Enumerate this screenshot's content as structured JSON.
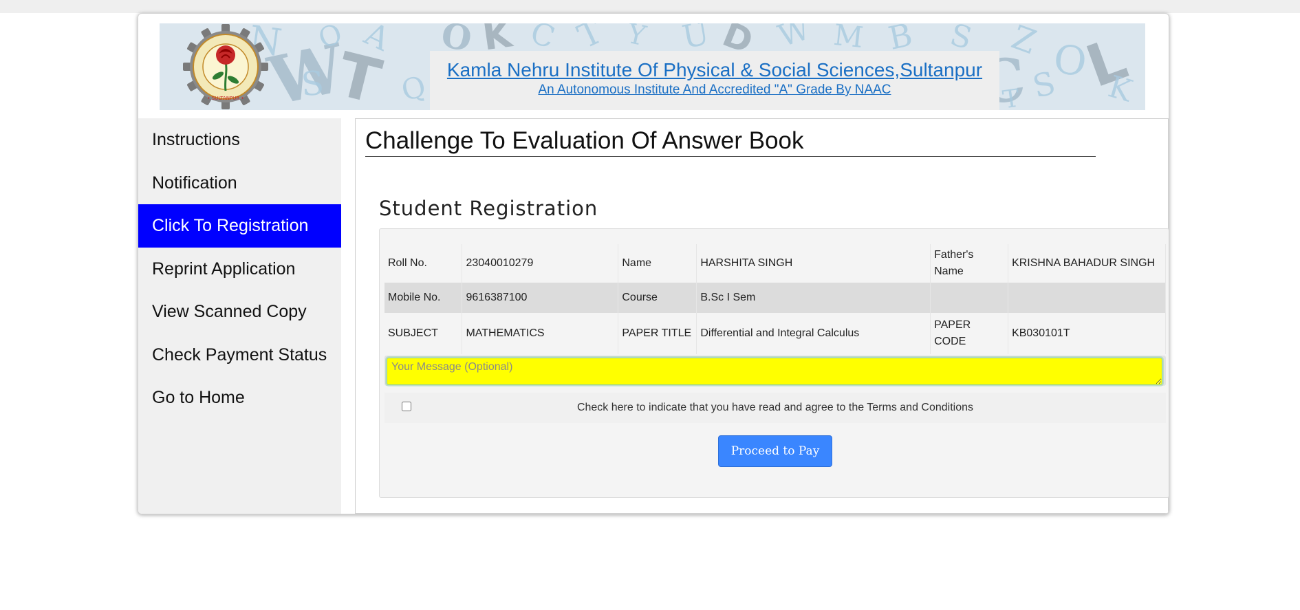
{
  "header": {
    "institute_name": "Kamla Nehru Institute Of Physical & Social Sciences,Sultanpur",
    "subtitle": "An Autonomous Institute And Accredited \"A\" Grade By NAAC",
    "logo_icon": "institute-seal-rose-icon",
    "logo_text": "KAMLA NEHRU INSTITUTE OF PHYSICAL & SOCIAL SCIENCES • SULTANPUR •"
  },
  "sidebar": {
    "items": [
      {
        "label": "Instructions",
        "active": false
      },
      {
        "label": "Notification",
        "active": false
      },
      {
        "label": "Click To Registration",
        "active": true
      },
      {
        "label": "Reprint Application",
        "active": false
      },
      {
        "label": "View Scanned Copy",
        "active": false
      },
      {
        "label": "Check Payment Status",
        "active": false
      },
      {
        "label": "Go to Home",
        "active": false
      }
    ]
  },
  "main": {
    "page_title": "Challenge To Evaluation Of Answer Book",
    "section_title": "Student Registration",
    "student": {
      "roll_label": "Roll No.",
      "roll_value": "23040010279",
      "name_label": "Name",
      "name_value": "HARSHITA SINGH",
      "father_label": "Father's Name",
      "father_value": "KRISHNA BAHADUR SINGH",
      "mobile_label": "Mobile No.",
      "mobile_value": "9616387100",
      "course_label": "Course",
      "course_value": "B.Sc I Sem",
      "subject_label": "SUBJECT",
      "subject_value": "MATHEMATICS",
      "paper_title_label": "PAPER TITLE",
      "paper_title_value": "Differential and Integral Calculus",
      "paper_code_label": "PAPER CODE",
      "paper_code_value": "KB030101T"
    },
    "message": {
      "placeholder": "Your Message (Optional)",
      "value": ""
    },
    "terms": {
      "label": "Check here to indicate that you have read and agree to the Terms and Conditions",
      "checked": false
    },
    "proceed_label": "Proceed to Pay"
  },
  "colors": {
    "active_nav": "#0000ff",
    "link": "#1a6fc4",
    "message_bg": "#ffff00",
    "button": "#3a86ff"
  }
}
